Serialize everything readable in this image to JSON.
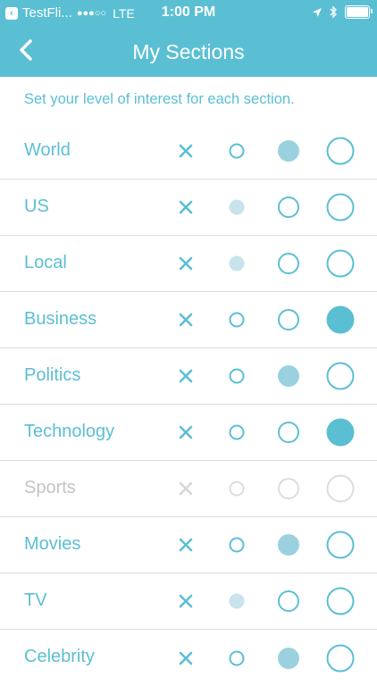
{
  "status_bar": {
    "carrier": "TestFli...",
    "signal": "●●●○○",
    "network": "LTE",
    "time": "1:00 PM",
    "icons": [
      "back-app-icon",
      "location-arrow-icon",
      "bluetooth-icon",
      "battery-icon"
    ]
  },
  "nav": {
    "title": "My Sections",
    "back_icon": "chevron-left-icon"
  },
  "instruction": "Set your level of interest for each section.",
  "colors": {
    "accent": "#5bbfd4",
    "selected_small": "#c8e3ec",
    "selected_medium": "#9bd1df",
    "selected_large": "#5bbfd4",
    "disabled": "#c4c4c4",
    "divider": "#dcdcdc"
  },
  "interest_levels": [
    "none",
    "low",
    "medium",
    "high"
  ],
  "sections": [
    {
      "name": "World",
      "level": 2,
      "enabled": true
    },
    {
      "name": "US",
      "level": 1,
      "enabled": true
    },
    {
      "name": "Local",
      "level": 1,
      "enabled": true
    },
    {
      "name": "Business",
      "level": 3,
      "enabled": true
    },
    {
      "name": "Politics",
      "level": 2,
      "enabled": true
    },
    {
      "name": "Technology",
      "level": 3,
      "enabled": true
    },
    {
      "name": "Sports",
      "level": null,
      "enabled": false
    },
    {
      "name": "Movies",
      "level": 2,
      "enabled": true
    },
    {
      "name": "TV",
      "level": 1,
      "enabled": true
    },
    {
      "name": "Celebrity",
      "level": 2,
      "enabled": true
    }
  ]
}
